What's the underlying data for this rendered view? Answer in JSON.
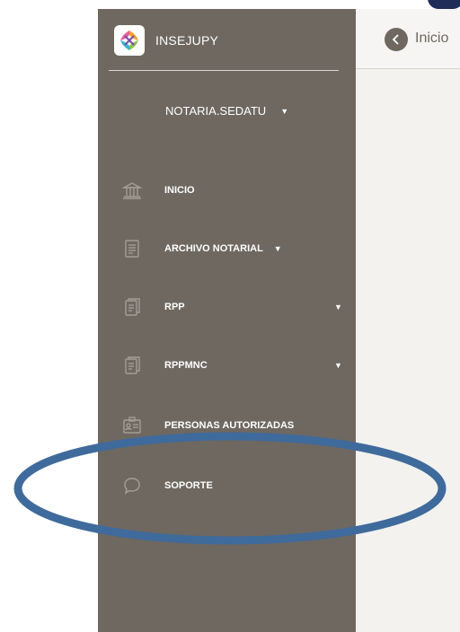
{
  "sidebar": {
    "brand": "INSEJUPY",
    "user": "NOTARIA.SEDATU",
    "items": [
      {
        "label": "INICIO",
        "icon": "bank-icon",
        "has_caret": false
      },
      {
        "label": "ARCHIVO NOTARIAL",
        "icon": "document-icon",
        "has_caret": true
      },
      {
        "label": "RPP",
        "icon": "documents-icon",
        "has_caret": true
      },
      {
        "label": "RPPMNC",
        "icon": "documents-icon",
        "has_caret": true
      },
      {
        "label": "PERSONAS AUTORIZADAS",
        "icon": "id-card-icon",
        "has_caret": false
      },
      {
        "label": "SOPORTE",
        "icon": "chat-icon",
        "has_caret": false
      }
    ]
  },
  "main": {
    "title": "Inicio"
  },
  "annotation": {
    "highlighted_item": "SOPORTE",
    "ellipse_color": "#3f6a9c"
  },
  "colors": {
    "sidebar_bg": "#6e6861",
    "main_bg": "#f3f2ef",
    "text_light": "#ffffff"
  }
}
